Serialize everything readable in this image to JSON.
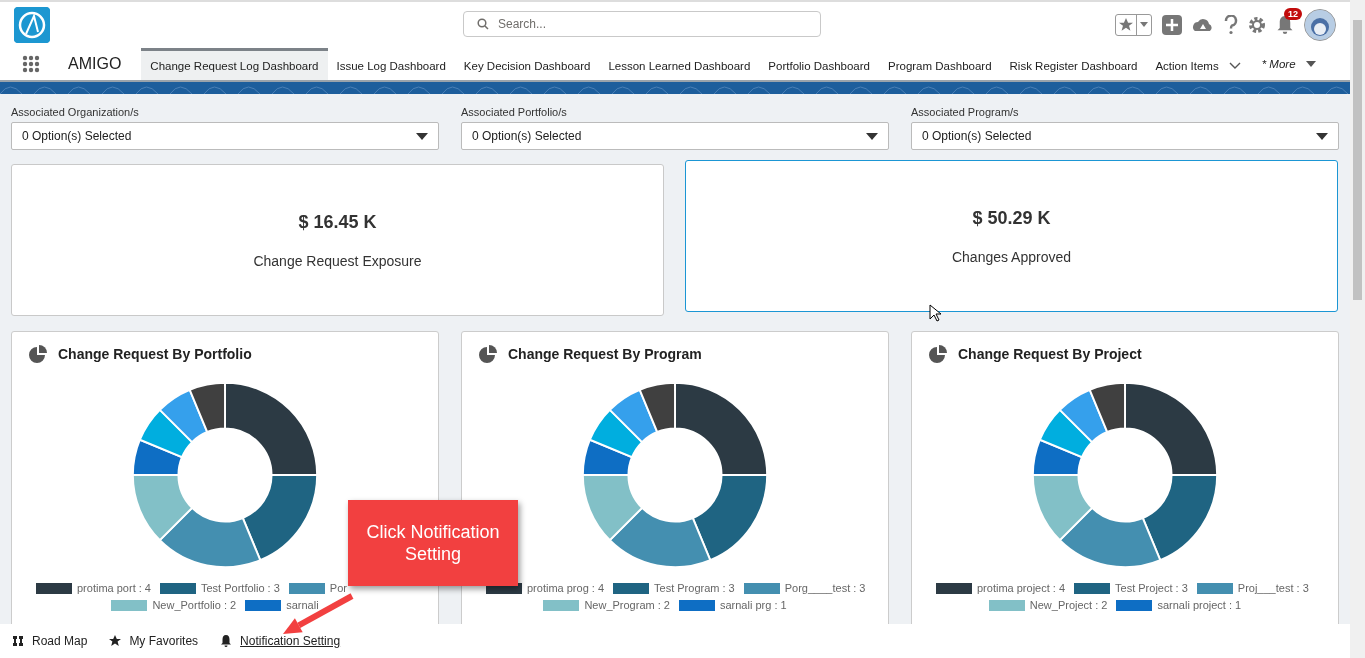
{
  "header": {
    "search_placeholder": "Search...",
    "notification_count": "12"
  },
  "nav": {
    "app_name": "AMIGO",
    "tabs": [
      {
        "label": "Change Request Log Dashboard",
        "selected": true
      },
      {
        "label": "Issue Log Dashboard",
        "selected": false
      },
      {
        "label": "Key Decision Dashboard",
        "selected": false
      },
      {
        "label": "Lesson Learned Dashboard",
        "selected": false
      },
      {
        "label": "Portfolio Dashboard",
        "selected": false
      },
      {
        "label": "Program Dashboard",
        "selected": false
      },
      {
        "label": "Risk Register Dashboard",
        "selected": false
      },
      {
        "label": "Action Items",
        "selected": false,
        "kind": "dropdown"
      }
    ],
    "more": "* More"
  },
  "filters": [
    {
      "label": "Associated Organization/s",
      "value": "0 Option(s) Selected"
    },
    {
      "label": "Associated Portfolio/s",
      "value": "0 Option(s) Selected"
    },
    {
      "label": "Associated Program/s",
      "value": "0 Option(s) Selected"
    }
  ],
  "kpis": [
    {
      "value": "$ 16.45 K",
      "label": "Change Request Exposure",
      "selected": false
    },
    {
      "value": "$ 50.29 K",
      "label": "Changes Approved",
      "selected": true
    }
  ],
  "charts": [
    {
      "title": "Change Request By Portfolio",
      "legend": [
        {
          "label": "protima port : 4",
          "color": "#2c3a44"
        },
        {
          "label": "Test Portfolio : 3",
          "color": "#1f6482"
        },
        {
          "label": "Por",
          "color": "#448fb0"
        },
        {
          "label": "New_Portfolio : 2",
          "color": "#82c0c7"
        },
        {
          "label": "sarnali",
          "color": "#0e6ec4"
        }
      ]
    },
    {
      "title": "Change Request By Program",
      "legend": [
        {
          "label": "protima prog : 4",
          "color": "#2c3a44"
        },
        {
          "label": "Test Program : 3",
          "color": "#1f6482"
        },
        {
          "label": "Porg____test : 3",
          "color": "#448fb0"
        },
        {
          "label": "New_Program : 2",
          "color": "#82c0c7"
        },
        {
          "label": "sarnali prg : 1",
          "color": "#0e6ec4"
        }
      ]
    },
    {
      "title": "Change Request By Project",
      "legend": [
        {
          "label": "protima project : 4",
          "color": "#2c3a44"
        },
        {
          "label": "Test Project : 3",
          "color": "#1f6482"
        },
        {
          "label": "Proj___test : 3",
          "color": "#448fb0"
        },
        {
          "label": "New_Project : 2",
          "color": "#82c0c7"
        },
        {
          "label": "sarnali project : 1",
          "color": "#0e6ec4"
        }
      ]
    }
  ],
  "footer": [
    {
      "label": "Road Map",
      "kind": "roadmap",
      "underlined": false
    },
    {
      "label": "My Favorites",
      "kind": "star",
      "underlined": false
    },
    {
      "label": "Notification Setting",
      "kind": "bell",
      "underlined": true
    }
  ],
  "callout": {
    "text": "Click Notification Setting"
  }
}
